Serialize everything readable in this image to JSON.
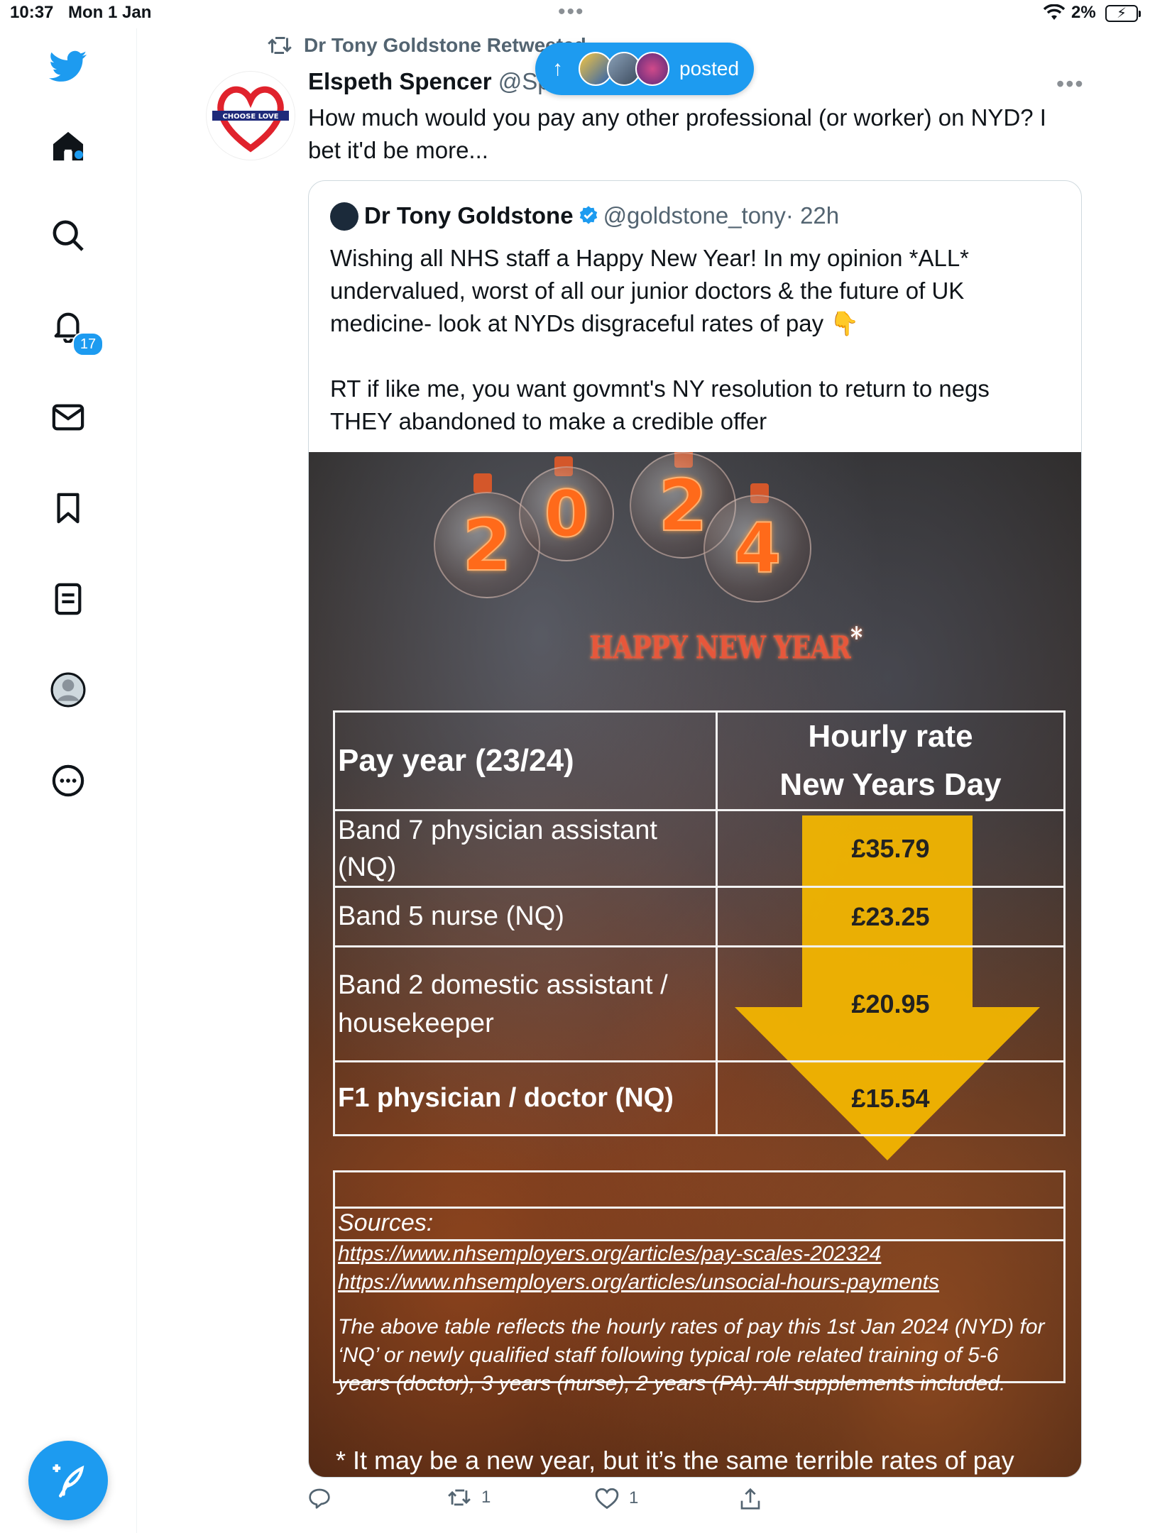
{
  "status_bar": {
    "time": "10:37",
    "date": "Mon 1 Jan",
    "battery": "2%"
  },
  "sidebar": {
    "notifications_count": "17",
    "items": [
      "home-icon",
      "search-icon",
      "notifications-icon",
      "messages-icon",
      "bookmarks-icon",
      "lists-icon",
      "profile-icon",
      "more-icon"
    ]
  },
  "tweet": {
    "retweeted_by": "Dr Tony Goldstone Retweeted",
    "author_name": "Elspeth Spencer",
    "author_handle": "@Sp",
    "text": "How much would you pay any other professional (or worker) on NYD? I\nbet it'd be more..."
  },
  "posted_pill": {
    "label": "posted"
  },
  "quote": {
    "name": "Dr Tony Goldstone",
    "handle": "@goldstone_tony",
    "time": "· 22h",
    "text": "Wishing all NHS staff a Happy New Year! In my opinion *ALL*\nundervalued, worst of all our junior doctors & the future of UK\nmedicine- look at NYDs disgraceful rates of pay 👇\n\nRT if like me, you want govmnt's NY resolution to return to negs\nTHEY abandoned to make a credible offer"
  },
  "image": {
    "year_digits": [
      "2",
      "0",
      "2",
      "4"
    ],
    "banner": "HAPPY NEW YEAR",
    "banner_mark": "*",
    "table": {
      "header_left": "Pay year (23/24)",
      "header_right_line1": "Hourly rate",
      "header_right_line2": "New Years Day",
      "rows": [
        {
          "role": "Band 7 physician assistant\n(NQ)",
          "rate": "£35.79"
        },
        {
          "role": "Band 5 nurse (NQ)",
          "rate": "£23.25"
        },
        {
          "role": "Band 2 domestic assistant /\nhousekeeper",
          "rate": "£20.95"
        },
        {
          "role": "F1 physician / doctor (NQ)",
          "rate": "£15.54"
        }
      ]
    },
    "sources_title": "Sources:",
    "source_urls": [
      "https://www.nhsemployers.org/articles/pay-scales-202324",
      "https://www.nhsemployers.org/articles/unsocial-hours-payments"
    ],
    "note": "The above table reflects the hourly rates of pay this 1st Jan 2024 (NYD) for\n‘NQ’ or newly qualified staff following typical role related training of 5-6\nyears (doctor), 3 years (nurse), 2 years (PA). All supplements included.",
    "footnote": "* It may be a new year, but it’s the same terrible rates of pay"
  },
  "actions": {
    "reply_count": "",
    "retweet_count": "1",
    "like_count": "1"
  },
  "colors": {
    "accent": "#1d9bf0",
    "arrow": "#f5b800"
  }
}
